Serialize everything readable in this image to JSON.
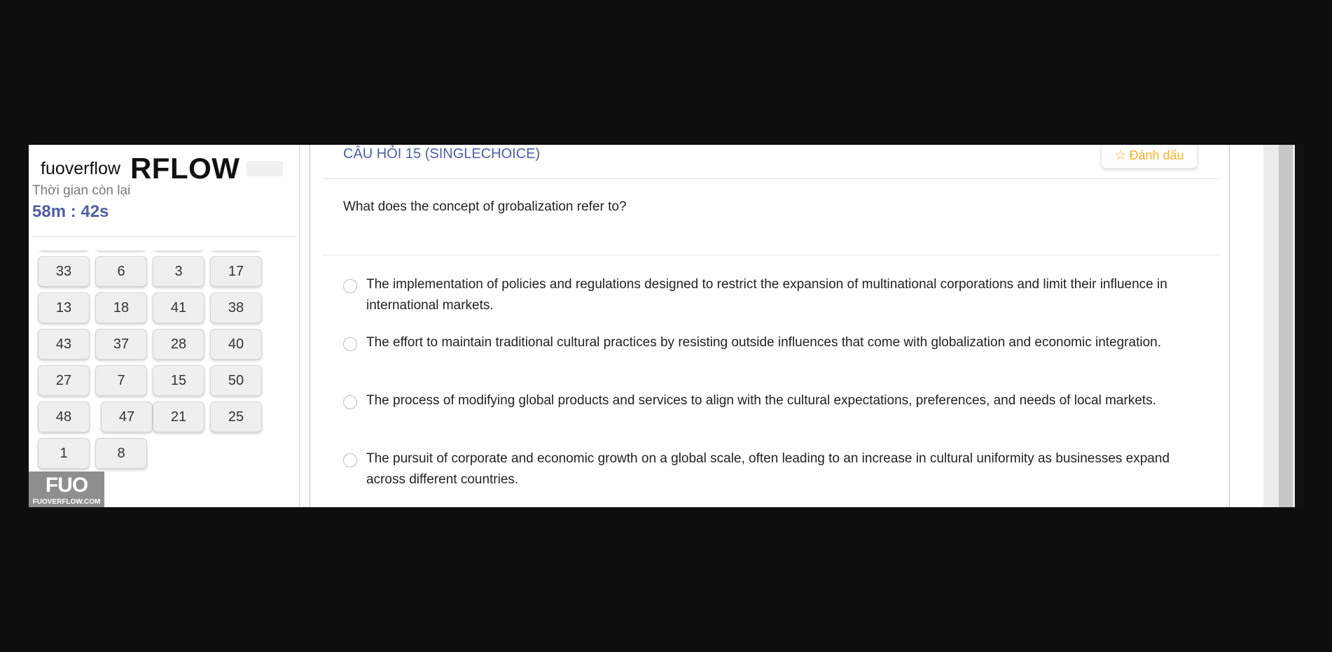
{
  "sidebar": {
    "brand_small": "fuoverflow",
    "brand_big": "RFLOW",
    "timer_label": "Thời gian còn lại",
    "timer_value": "58m : 42s",
    "question_numbers": [
      "",
      "",
      "",
      "",
      "33",
      "6",
      "3",
      "17",
      "13",
      "18",
      "41",
      "38",
      "43",
      "37",
      "28",
      "40",
      "27",
      "7",
      "15",
      "50",
      "48",
      "47",
      "21",
      "25",
      "1",
      "8"
    ],
    "logo_mark": "FUO",
    "logo_url": "FUOVERFLOW.COM"
  },
  "question": {
    "title": "CÂU HỎI 15 (SINGLECHOICE)",
    "mark_label": "Đánh dấu",
    "mark_icon": "star-outline-icon",
    "text": "What does the concept of grobalization refer to?",
    "options": [
      "The implementation of policies and regulations designed to restrict the expansion of multinational corporations and limit their influence in international markets.",
      "The effort to maintain traditional cultural practices by resisting outside influences that come with globalization and economic integration.",
      "The process of modifying global products and services to align with the cultural expectations, preferences, and needs of local markets.",
      "The pursuit of corporate and economic growth on a global scale, often leading to an increase in cultural uniformity as businesses expand across different countries."
    ]
  },
  "colors": {
    "accent": "#4f5fa0",
    "mark": "#f0b429",
    "background": "#0e0e0e"
  }
}
